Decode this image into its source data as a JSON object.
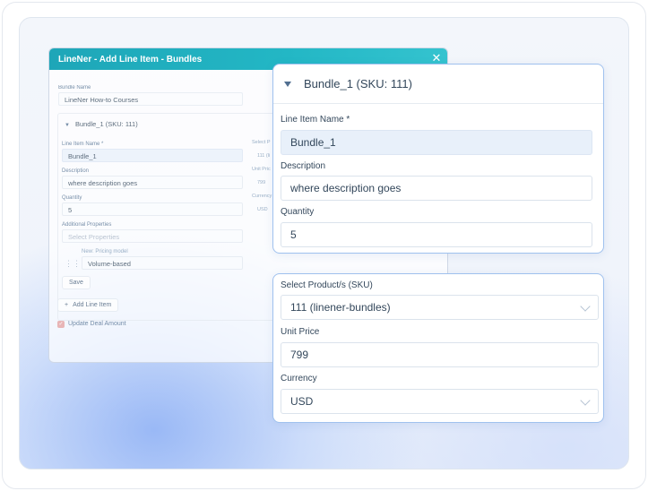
{
  "modal": {
    "title": "LineNer - Add Line Item - Bundles",
    "bundle_name_label": "Bundle Name",
    "bundle_name_value": "LineNer How-to Courses",
    "bundle_header": "Bundle_1 (SKU: 111)",
    "line_item_name_label": "Line Item Name *",
    "line_item_name_value": "Bundle_1",
    "description_label": "Description",
    "description_value": "where description goes",
    "quantity_label": "Quantity",
    "quantity_value": "5",
    "additional_properties_label": "Additional Properties",
    "select_properties_placeholder": "Select Properties",
    "pricing_model_label": "New: Pricing model",
    "pricing_model_value": "Volume-based",
    "save_label": "Save",
    "add_line_item_label": "Add Line Item",
    "update_deal_amount_label": "Update Deal Amount",
    "side_labels": [
      "Select P",
      "111 (li",
      "Unit Pric",
      "799",
      "Currency",
      "USD"
    ]
  },
  "panel_top": {
    "header": "Bundle_1 (SKU: 111)",
    "line_item_name_label": "Line Item Name *",
    "line_item_name_value": "Bundle_1",
    "description_label": "Description",
    "description_value": "where description goes",
    "quantity_label": "Quantity",
    "quantity_value": "5"
  },
  "panel_bottom": {
    "product_label": "Select Product/s (SKU)",
    "product_value": "111 (linener-bundles)",
    "unit_price_label": "Unit Price",
    "unit_price_value": "799",
    "currency_label": "Currency",
    "currency_value": "USD"
  }
}
